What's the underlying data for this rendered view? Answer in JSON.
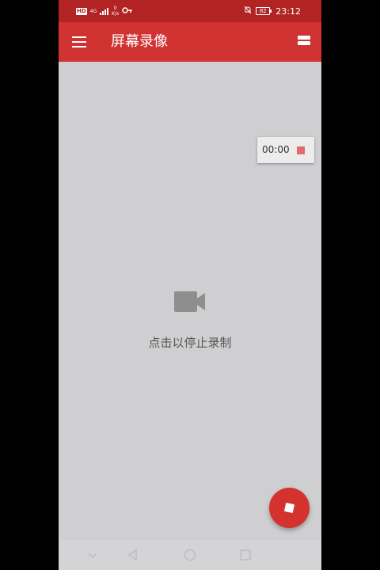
{
  "status_bar": {
    "hd_label": "HD",
    "network_label": "4G",
    "net_speed_value": "0",
    "net_speed_unit": "K/s",
    "battery_level": "82",
    "time": "23:12"
  },
  "app_bar": {
    "title": "屏幕录像"
  },
  "timer": {
    "elapsed": "00:00"
  },
  "center": {
    "hint": "点击以停止录制"
  },
  "colors": {
    "status_bar": "#b22323",
    "app_bar": "#d13232",
    "fab": "#d3322e",
    "background": "#cfcfd1",
    "timer_stop": "#e06c6c"
  },
  "icons": {
    "menu": "hamburger-menu-icon",
    "layout": "layout-toggle-icon",
    "camera": "video-camera-icon",
    "stop": "stop-square-icon"
  }
}
